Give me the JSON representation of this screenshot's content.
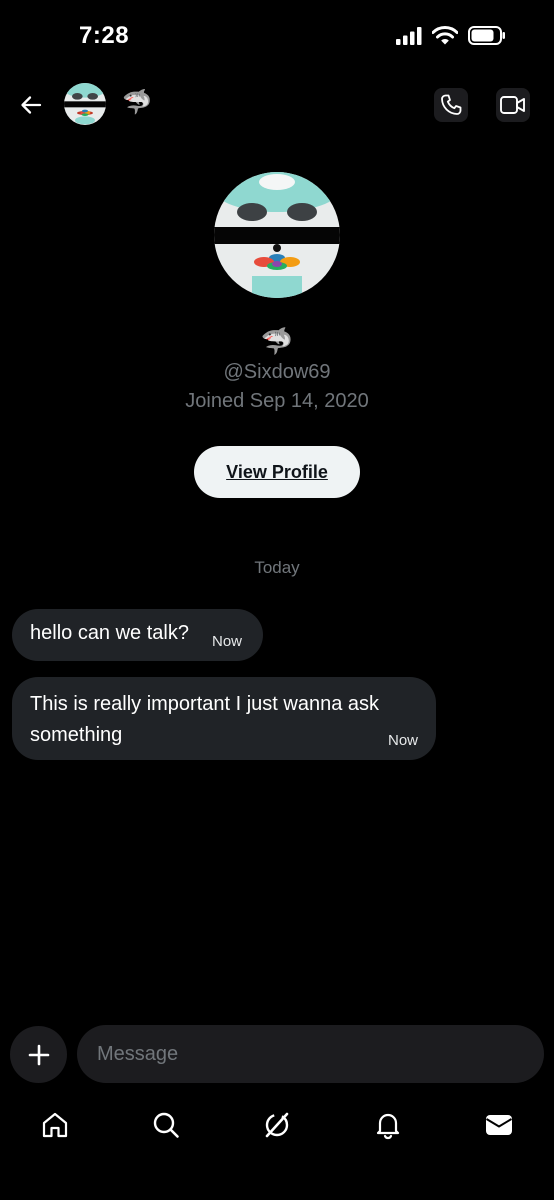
{
  "status_bar": {
    "time": "7:28"
  },
  "conversation": {
    "header_emoji": "🦈",
    "profile": {
      "emoji": "🦈",
      "handle": "@Sixdow69",
      "joined": "Joined Sep 14, 2020",
      "view_profile_label": "View Profile"
    },
    "day_divider": "Today",
    "messages": [
      {
        "text": "hello can we talk?",
        "time": "Now"
      },
      {
        "text": "This is really important I just wanna ask something",
        "time": "Now"
      }
    ]
  },
  "composer": {
    "placeholder": "Message"
  },
  "icons": {
    "back": "back-arrow-icon",
    "call": "phone-icon",
    "video": "video-camera-icon",
    "add": "plus-icon",
    "tabs": [
      "home-icon",
      "search-icon",
      "grok-icon",
      "bell-icon",
      "mail-icon"
    ]
  },
  "colors": {
    "background": "#000000",
    "bubble": "#202327",
    "muted_text": "#71767b",
    "button_bg": "#eff3f4"
  }
}
